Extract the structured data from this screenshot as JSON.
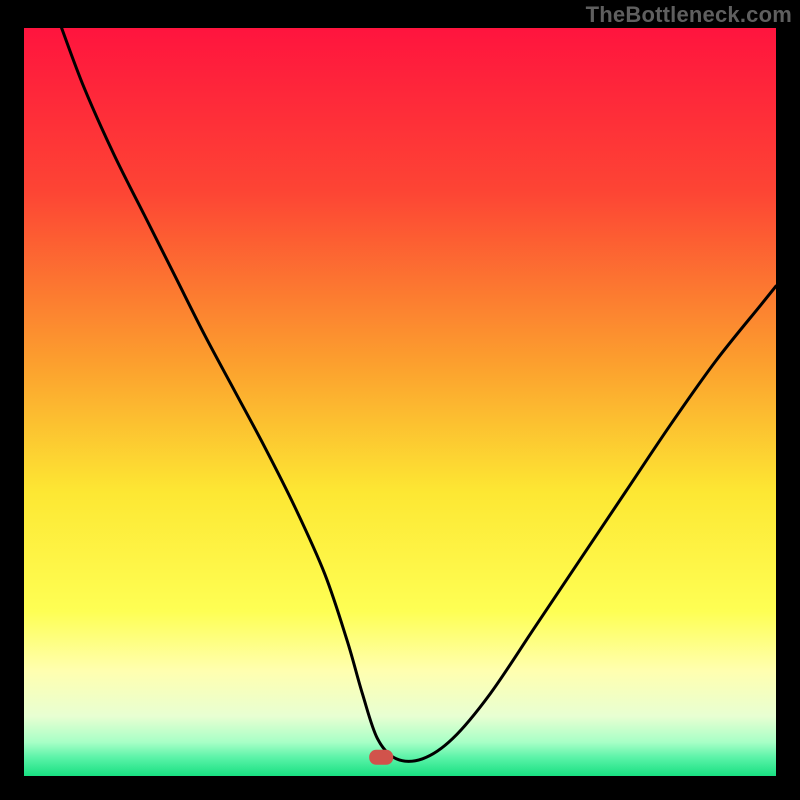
{
  "attribution": "TheBottleneck.com",
  "chart_data": {
    "type": "line",
    "title": "",
    "xlabel": "",
    "ylabel": "",
    "xlim": [
      0,
      100
    ],
    "ylim": [
      0,
      100
    ],
    "grid": false,
    "legend": false,
    "background_gradient": {
      "stops": [
        {
          "offset": 0.0,
          "color": "#ff143e"
        },
        {
          "offset": 0.22,
          "color": "#fd4534"
        },
        {
          "offset": 0.45,
          "color": "#fca02e"
        },
        {
          "offset": 0.62,
          "color": "#fde733"
        },
        {
          "offset": 0.78,
          "color": "#feff54"
        },
        {
          "offset": 0.86,
          "color": "#ffffb0"
        },
        {
          "offset": 0.92,
          "color": "#e8ffd2"
        },
        {
          "offset": 0.955,
          "color": "#a7ffc6"
        },
        {
          "offset": 0.975,
          "color": "#5cf3a8"
        },
        {
          "offset": 1.0,
          "color": "#18e082"
        }
      ]
    },
    "marker": {
      "x": 47.5,
      "y": 2.5,
      "color": "#d1534b"
    },
    "series": [
      {
        "name": "curve",
        "x": [
          5,
          8,
          12,
          16,
          20,
          24,
          28,
          32,
          36,
          40,
          43,
          45,
          47,
          49.5,
          53,
          57,
          62,
          68,
          74,
          80,
          86,
          92,
          98,
          100
        ],
        "y": [
          100,
          92,
          83,
          75,
          67,
          59,
          51.5,
          44,
          36,
          27,
          18,
          11,
          5,
          2.3,
          2.3,
          5,
          11,
          20,
          29,
          38,
          47,
          55.5,
          63,
          65.5
        ]
      }
    ]
  }
}
